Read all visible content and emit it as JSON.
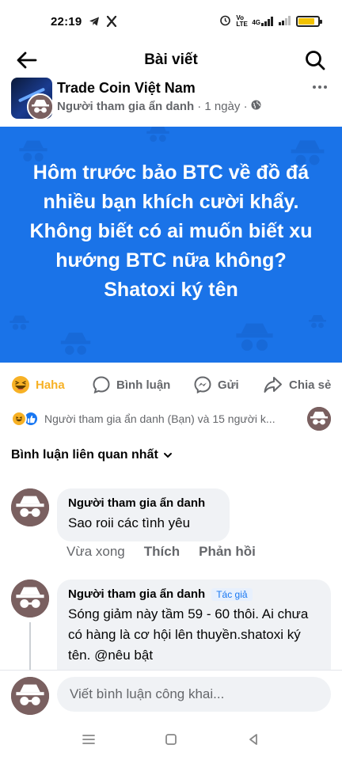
{
  "status_bar": {
    "time": "22:19",
    "left_icons": [
      "telegram-icon",
      "x-icon"
    ],
    "right_icons": [
      "alarm-icon",
      "volte-icon",
      "signal-4g-icon",
      "signal-icon",
      "battery-icon"
    ],
    "network_label": "4G",
    "volte_label": "Vo LTE",
    "battery_level": 0.85,
    "battery_color": "#f2c200"
  },
  "header": {
    "title": "Bài viết"
  },
  "post": {
    "group_name": "Trade Coin Việt Nam",
    "author": "Người tham gia ẩn danh",
    "time": "· 1 ngày ·",
    "privacy_icon": "globe-icon",
    "image_text": "Hôm trước bảo BTC về đồ đá nhiều bạn khích cười khẩy. Không biết có ai muốn biết xu hướng BTC nữa không? Shatoxi ký tên",
    "image_bg": "#1a73e8"
  },
  "actions": {
    "haha": "Haha",
    "comment": "Bình luận",
    "send": "Gửi",
    "share": "Chia sẻ"
  },
  "reactions": {
    "summary": "Người tham gia ẩn danh (Bạn) và 15 người k..."
  },
  "comments_section": {
    "sort_label": "Bình luận liên quan nhất"
  },
  "comments": [
    {
      "author": "Người tham gia ẩn danh",
      "text": "Sao roii các tình yêu",
      "time": "Vừa xong",
      "like": "Thích",
      "reply": "Phản hồi"
    },
    {
      "author": "Người tham gia ẩn danh",
      "badge": "Tác giả",
      "text": "Sóng giảm này tầm 59 - 60 thôi. Ai chưa có hàng là cơ hội lên thuyền.shatoxi ký tên. @nêu bật"
    }
  ],
  "composer": {
    "placeholder": "Viết bình luận công khai..."
  },
  "colors": {
    "accent": "#1877f2",
    "haha": "#f7b125",
    "secondary_text": "#65676b",
    "bubble": "#f0f2f5"
  }
}
